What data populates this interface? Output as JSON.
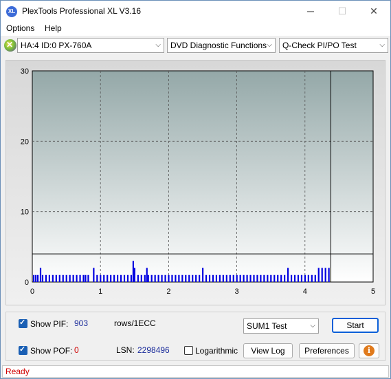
{
  "window": {
    "title": "PlexTools Professional XL V3.16",
    "icon_label": "XL"
  },
  "window_controls": {
    "minimize": "─",
    "maximize": "☐",
    "close": "✕"
  },
  "menu": {
    "items": [
      "Options",
      "Help"
    ]
  },
  "toolbar": {
    "drive": "HA:4 ID:0  PX-760A",
    "function": "DVD Diagnostic Functions",
    "test": "Q-Check PI/PO Test"
  },
  "chart_data": {
    "type": "bar",
    "title": "",
    "xlabel": "",
    "ylabel": "",
    "xlim": [
      0,
      5
    ],
    "ylim": [
      0,
      30
    ],
    "x_ticks": [
      "0",
      "1",
      "2",
      "3",
      "4",
      "5"
    ],
    "y_ticks": [
      "0",
      "10",
      "20",
      "30"
    ],
    "grid": true,
    "threshold_line": 4,
    "end_marker_x": 4.38,
    "series": [
      {
        "color": "#0000e0",
        "points": [
          [
            0.02,
            1
          ],
          [
            0.05,
            1
          ],
          [
            0.08,
            1
          ],
          [
            0.12,
            2
          ],
          [
            0.15,
            1
          ],
          [
            0.2,
            1
          ],
          [
            0.25,
            1
          ],
          [
            0.3,
            1
          ],
          [
            0.35,
            1
          ],
          [
            0.4,
            1
          ],
          [
            0.45,
            1
          ],
          [
            0.5,
            1
          ],
          [
            0.55,
            1
          ],
          [
            0.6,
            1
          ],
          [
            0.65,
            1
          ],
          [
            0.7,
            1
          ],
          [
            0.75,
            1
          ],
          [
            0.78,
            1
          ],
          [
            0.82,
            1
          ],
          [
            0.9,
            2
          ],
          [
            0.95,
            1
          ],
          [
            1.0,
            1
          ],
          [
            1.05,
            1
          ],
          [
            1.1,
            1
          ],
          [
            1.15,
            1
          ],
          [
            1.2,
            1
          ],
          [
            1.25,
            1
          ],
          [
            1.3,
            1
          ],
          [
            1.35,
            1
          ],
          [
            1.4,
            1
          ],
          [
            1.45,
            1
          ],
          [
            1.48,
            3
          ],
          [
            1.5,
            2
          ],
          [
            1.55,
            1
          ],
          [
            1.6,
            1
          ],
          [
            1.65,
            1
          ],
          [
            1.68,
            2
          ],
          [
            1.7,
            1
          ],
          [
            1.75,
            1
          ],
          [
            1.8,
            1
          ],
          [
            1.85,
            1
          ],
          [
            1.9,
            1
          ],
          [
            1.95,
            1
          ],
          [
            2.0,
            1
          ],
          [
            2.05,
            1
          ],
          [
            2.1,
            1
          ],
          [
            2.15,
            1
          ],
          [
            2.2,
            1
          ],
          [
            2.25,
            1
          ],
          [
            2.3,
            1
          ],
          [
            2.35,
            1
          ],
          [
            2.4,
            1
          ],
          [
            2.45,
            1
          ],
          [
            2.5,
            2
          ],
          [
            2.55,
            1
          ],
          [
            2.6,
            1
          ],
          [
            2.65,
            1
          ],
          [
            2.7,
            1
          ],
          [
            2.75,
            1
          ],
          [
            2.8,
            1
          ],
          [
            2.85,
            1
          ],
          [
            2.9,
            1
          ],
          [
            2.95,
            1
          ],
          [
            3.0,
            1
          ],
          [
            3.05,
            1
          ],
          [
            3.1,
            1
          ],
          [
            3.15,
            1
          ],
          [
            3.2,
            1
          ],
          [
            3.25,
            1
          ],
          [
            3.3,
            1
          ],
          [
            3.35,
            1
          ],
          [
            3.4,
            1
          ],
          [
            3.45,
            1
          ],
          [
            3.5,
            1
          ],
          [
            3.55,
            1
          ],
          [
            3.6,
            1
          ],
          [
            3.65,
            1
          ],
          [
            3.7,
            1
          ],
          [
            3.75,
            2
          ],
          [
            3.8,
            1
          ],
          [
            3.85,
            1
          ],
          [
            3.9,
            1
          ],
          [
            3.95,
            1
          ],
          [
            4.0,
            1
          ],
          [
            4.05,
            1
          ],
          [
            4.1,
            1
          ],
          [
            4.15,
            1
          ],
          [
            4.2,
            2
          ],
          [
            4.25,
            2
          ],
          [
            4.3,
            2
          ],
          [
            4.35,
            2
          ]
        ]
      }
    ]
  },
  "controls": {
    "show_pif_label": "Show PIF:",
    "pif_value": "903",
    "rows_unit": "rows/1ECC",
    "show_pof_label": "Show POF:",
    "pof_value": "0",
    "lsn_label": "LSN:",
    "lsn_value": "2298496",
    "logarithmic_label": "Logarithmic",
    "test_select": "SUM1 Test",
    "start_label": "Start",
    "view_log_label": "View Log",
    "preferences_label": "Preferences",
    "info_icon": "i"
  },
  "status": {
    "text": "Ready"
  }
}
